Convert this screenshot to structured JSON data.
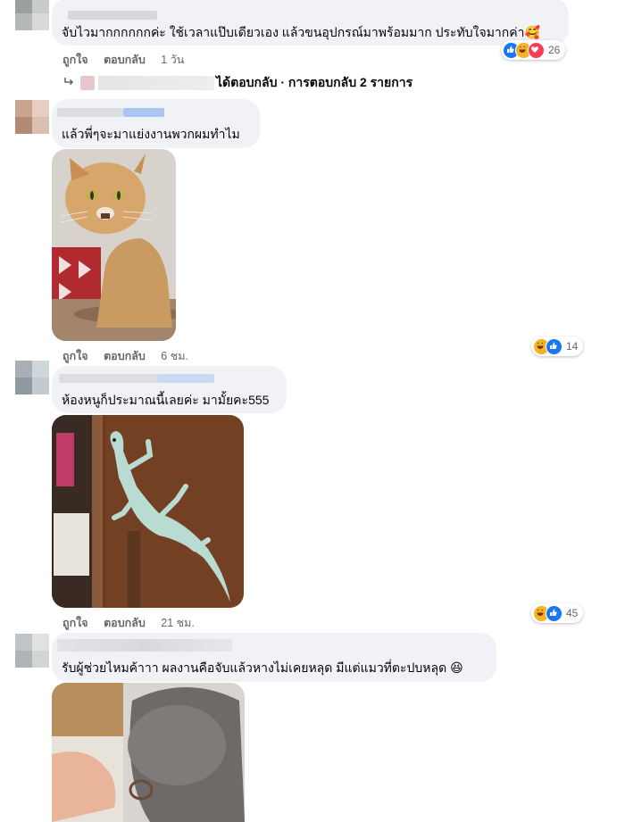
{
  "comments": [
    {
      "text": "จับไวมากกกกกกค่ะ ใช้เวลาแป๊บเดียวเอง แล้วขนอุปกรณ์มาพร้อมมาก ประทับใจมากค่า🥰",
      "like_label": "ถูกใจ",
      "reply_label": "ตอบกลับ",
      "time": "1 วัน",
      "reaction_count": "26",
      "reactions": [
        "like-icon",
        "haha-icon",
        "love-icon"
      ],
      "replies_summary": "ได้ตอบกลับ · การตอบกลับ 2 รายการ"
    },
    {
      "text": "แล้วพี่ๆจะมาแย่งงานพวกผมทำไม",
      "like_label": "ถูกใจ",
      "reply_label": "ตอบกลับ",
      "time": "6 ชม.",
      "reaction_count": "14",
      "reactions": [
        "haha-icon",
        "like-icon"
      ],
      "photo": "cat-photo"
    },
    {
      "text": "ห้องหนูก็ประมาณนี้เลยค่ะ มามั้ยคะ555",
      "like_label": "ถูกใจ",
      "reply_label": "ตอบกลับ",
      "time": "21 ชม.",
      "reaction_count": "45",
      "reactions": [
        "haha-icon",
        "like-icon"
      ],
      "photo": "gecko-photo"
    },
    {
      "text": "รับผู้ช่วยไหมค้าาา ผลงานคือจับแล้วหางไม่เคยหลุด มีแต่แมวที่ตะปบหลุด 😆",
      "photo": "cat-holding-photo"
    }
  ],
  "colors": {
    "bubble": "#f0f2f5",
    "meta_text": "#65676b",
    "like_blue": "#1877f2",
    "haha_yellow": "#f7b125",
    "love_red": "#f33e58"
  }
}
